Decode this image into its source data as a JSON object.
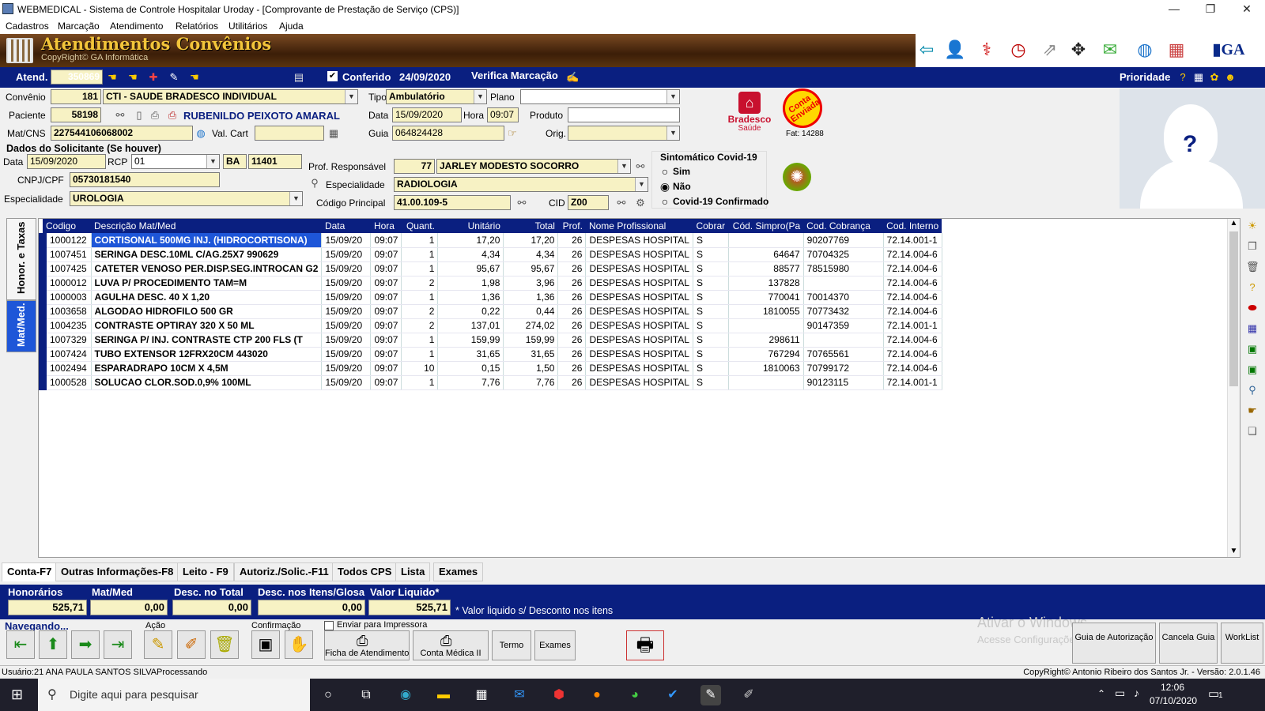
{
  "window": {
    "title": "WEBMEDICAL - Sistema de Controle Hospitalar Uroday - [Comprovante de Prestação de Serviço  (CPS)]",
    "minimize": "—",
    "restore": "❐",
    "close": "✕"
  },
  "menu": [
    "Cadastros",
    "Marcação",
    "Atendimento",
    "Relatórios",
    "Utilitários",
    "Ajuda"
  ],
  "banner": {
    "title": "Atendimentos Convênios",
    "subtitle": "CopyRight© GA Informática"
  },
  "bluebar": {
    "atend_label": "Atend.",
    "atend_value": "350869",
    "conferido_label": "Conferido",
    "conferido_date": "24/09/2020",
    "verifica_label": "Verifica Marcação",
    "prioridade_label": "Prioridade"
  },
  "form": {
    "convenio_label": "Convênio",
    "convenio_code": "181",
    "convenio_name": "CTI - SAUDE BRADESCO INDIVIDUAL",
    "tipo_label": "Tipo",
    "tipo_value": "Ambulatório",
    "plano_label": "Plano",
    "plano_value": "",
    "paciente_label": "Paciente",
    "paciente_code": "58198",
    "paciente_name": "RUBENILDO PEIXOTO AMARAL",
    "data_label": "Data",
    "data_value": "15/09/2020",
    "hora_label": "Hora",
    "hora_value": "09:07",
    "produto_label": "Produto",
    "produto_value": "",
    "matcns_label": "Mat/CNS",
    "matcns_value": "227544106068002",
    "valcart_label": "Val. Cart",
    "valcart_value": "",
    "guia_label": "Guia",
    "guia_value": "064824428",
    "orig_label": "Orig.",
    "orig_value": "",
    "solicitante_title": "Dados do Solicitante (Se houver)",
    "sol_data_label": "Data",
    "sol_data_value": "15/09/2020",
    "rcp_label": "RCP",
    "rcp_value": "01",
    "uf_value": "BA",
    "crm_value": "11401",
    "cnpj_label": "CNPJ/CPF",
    "cnpj_value": "05730181540",
    "esp_sol_label": "Especialidade",
    "esp_sol_value": "UROLOGIA",
    "prof_label": "Prof. Responsável",
    "prof_code": "77",
    "prof_name": "JARLEY MODESTO SOCORRO",
    "esp_label": "Especialidade",
    "esp_value": "RADIOLOGIA",
    "cod_principal_label": "Código Principal",
    "cod_principal_value": "41.00.109-5",
    "cid_label": "CID",
    "cid_value": "Z00",
    "covid_title": "Sintomático Covid-19",
    "covid_options": [
      "Sim",
      "Não",
      "Covid-19 Confirmado"
    ],
    "covid_selected": "Não",
    "bradesco_name": "Bradesco",
    "bradesco_sub": "Saúde",
    "stamp_text": "Conta Enviada",
    "fat_text": "Fat: 14288",
    "photo_placeholder": "?"
  },
  "side_tabs": [
    "Honor. e Taxas",
    "Mat/Med."
  ],
  "table": {
    "columns": [
      "Codigo",
      "Descrição Mat/Med",
      "Data",
      "Hora",
      "Quant.",
      "Unitário",
      "Total",
      "Prof.",
      "Nome Profissional",
      "Cobrar",
      "Cód. Simpro(Pa",
      "Cod. Cobrança",
      "Cod. Interno"
    ],
    "rows": [
      [
        "1000122",
        "CORTISONAL 500MG INJ. (HIDROCORTISONA)",
        "15/09/20",
        "09:07",
        "1",
        "17,20",
        "17,20",
        "26",
        "DESPESAS HOSPITAL",
        "S",
        "",
        "90207769",
        "72.14.001-1"
      ],
      [
        "1007451",
        "SERINGA DESC.10ML C/AG.25X7 990629",
        "15/09/20",
        "09:07",
        "1",
        "4,34",
        "4,34",
        "26",
        "DESPESAS HOSPITAL",
        "S",
        "64647",
        "70704325",
        "72.14.004-6"
      ],
      [
        "1007425",
        "CATETER VENOSO PER.DISP.SEG.INTROCAN G2",
        "15/09/20",
        "09:07",
        "1",
        "95,67",
        "95,67",
        "26",
        "DESPESAS HOSPITAL",
        "S",
        "88577",
        "78515980",
        "72.14.004-6"
      ],
      [
        "1000012",
        "LUVA P/ PROCEDIMENTO TAM=M",
        "15/09/20",
        "09:07",
        "2",
        "1,98",
        "3,96",
        "26",
        "DESPESAS HOSPITAL",
        "S",
        "137828",
        "",
        "72.14.004-6"
      ],
      [
        "1000003",
        "AGULHA DESC. 40 X 1,20",
        "15/09/20",
        "09:07",
        "1",
        "1,36",
        "1,36",
        "26",
        "DESPESAS HOSPITAL",
        "S",
        "770041",
        "70014370",
        "72.14.004-6"
      ],
      [
        "1003658",
        "ALGODAO HIDROFILO 500 GR",
        "15/09/20",
        "09:07",
        "2",
        "0,22",
        "0,44",
        "26",
        "DESPESAS HOSPITAL",
        "S",
        "1810055",
        "70773432",
        "72.14.004-6"
      ],
      [
        "1004235",
        "CONTRASTE OPTIRAY 320 X 50 ML",
        "15/09/20",
        "09:07",
        "2",
        "137,01",
        "274,02",
        "26",
        "DESPESAS HOSPITAL",
        "S",
        "",
        "90147359",
        "72.14.001-1"
      ],
      [
        "1007329",
        "SERINGA P/ INJ. CONTRASTE CTP 200 FLS (T",
        "15/09/20",
        "09:07",
        "1",
        "159,99",
        "159,99",
        "26",
        "DESPESAS HOSPITAL",
        "S",
        "298611",
        "",
        "72.14.004-6"
      ],
      [
        "1007424",
        "TUBO EXTENSOR 12FRX20CM 443020",
        "15/09/20",
        "09:07",
        "1",
        "31,65",
        "31,65",
        "26",
        "DESPESAS HOSPITAL",
        "S",
        "767294",
        "70765561",
        "72.14.004-6"
      ],
      [
        "1002494",
        "ESPARADRAPO 10CM X 4,5M",
        "15/09/20",
        "09:07",
        "10",
        "0,15",
        "1,50",
        "26",
        "DESPESAS HOSPITAL",
        "S",
        "1810063",
        "70799172",
        "72.14.004-6"
      ],
      [
        "1000528",
        "SOLUCAO CLOR.SOD.0,9% 100ML",
        "15/09/20",
        "09:07",
        "1",
        "7,76",
        "7,76",
        "26",
        "DESPESAS HOSPITAL",
        "S",
        "",
        "90123115",
        "72.14.001-1"
      ]
    ]
  },
  "bottom_tabs": [
    "Conta-F7",
    "Outras Informações-F8",
    "Leito - F9",
    "Autoriz./Solic.-F11",
    "Todos CPS",
    "Lista",
    "Exames"
  ],
  "totals": {
    "honorarios_label": "Honorários",
    "honorarios_value": "525,71",
    "matmed_label": "Mat/Med",
    "matmed_value": "0,00",
    "desc_total_label": "Desc. no Total",
    "desc_total_value": "0,00",
    "desc_itens_label": "Desc. nos Itens/Glosa",
    "desc_itens_value": "0,00",
    "liquido_label": "Valor Liquido*",
    "liquido_value": "525,71",
    "note": "* Valor liquido s/ Desconto nos itens"
  },
  "actions": {
    "navegando_label": "Navegando...",
    "acao_label": "Ação",
    "confirmacao_label": "Confirmação",
    "enviar_impressora": "Enviar para Impressora",
    "ficha_btn": "Ficha de Atendimento",
    "conta_medica_btn": "Conta Médica II",
    "termo_btn": "Termo",
    "exames_btn": "Exames",
    "guia_aut_btn": "Guia de Autorização",
    "cancela_guia_btn": "Cancela Guia",
    "worklist_btn": "WorkList",
    "watermark1": "Ativar o Windows",
    "watermark2": "Acesse Configurações"
  },
  "status": {
    "user": "Usuário:21 ANA PAULA SANTOS SILVAProcessando",
    "copyright": "CopyRight© Antonio Ribeiro dos Santos Jr. - Versão: 2.0.1.46"
  },
  "taskbar": {
    "search_placeholder": "Digite aqui para pesquisar",
    "time": "12:06",
    "date": "07/10/2020",
    "notif_count": "1"
  }
}
